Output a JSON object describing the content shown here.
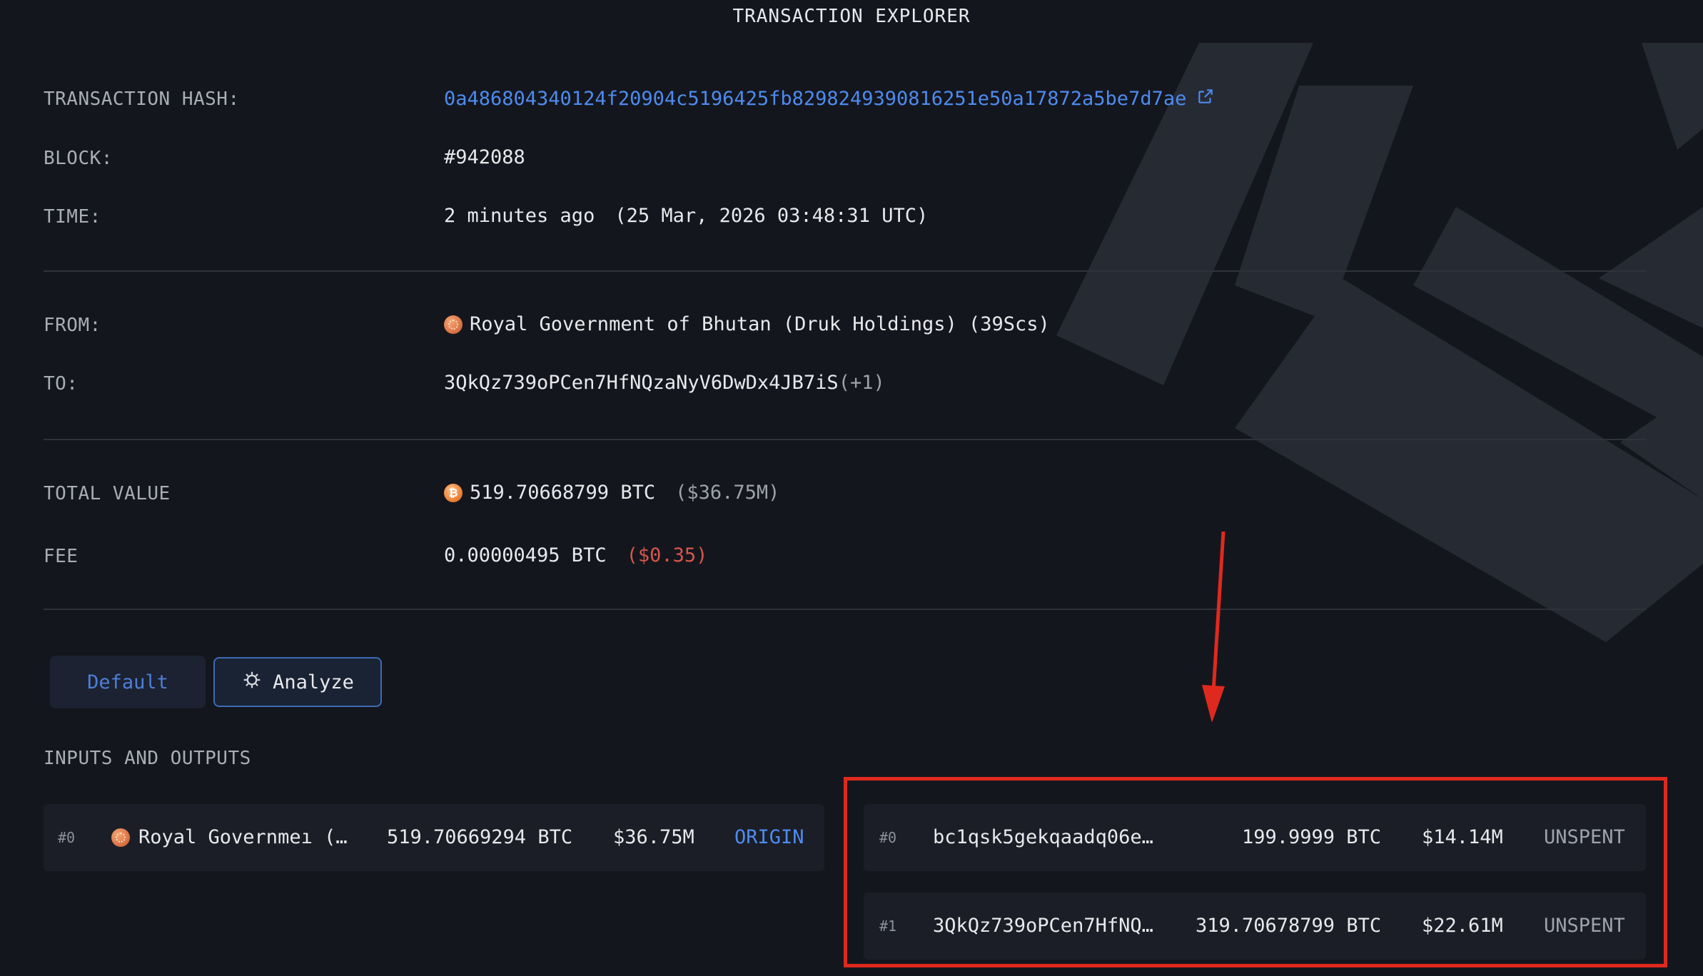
{
  "page": {
    "title": "TRANSACTION EXPLORER"
  },
  "details": {
    "hash_label": "TRANSACTION HASH:",
    "hash_value": "0a486804340124f20904c5196425fb8298249390816251e50a17872a5be7d7ae",
    "block_label": "BLOCK:",
    "block_value": "#942088",
    "time_label": "TIME:",
    "time_relative": "2 minutes ago",
    "time_absolute": "(25 Mar, 2026 03:48:31 UTC)",
    "from_label": "FROM:",
    "from_value": "Royal Government of Bhutan (Druk Holdings) (39Scs)",
    "to_label": "TO:",
    "to_value": "3QkQz739oPCen7HfNQzaNyV6DwDx4JB7iS",
    "to_extra": "(+1)",
    "total_label": "TOTAL VALUE",
    "total_value": "519.70668799 BTC",
    "total_usd": "($36.75M)",
    "fee_label": "FEE",
    "fee_value": "0.00000495 BTC",
    "fee_usd": "($0.35)"
  },
  "tabs": {
    "default_label": "Default",
    "analyze_label": "Analyze"
  },
  "io": {
    "heading": "INPUTS AND OUTPUTS",
    "inputs": [
      {
        "index": "#0",
        "name": "Royal Governmeı (…",
        "amount": "519.70669294 BTC",
        "usd": "$36.75M",
        "status": "ORIGIN"
      }
    ],
    "outputs": [
      {
        "index": "#0",
        "address": "bc1qsk5gekqaadq06e…",
        "amount": "199.9999 BTC",
        "usd": "$14.14M",
        "status": "UNSPENT"
      },
      {
        "index": "#1",
        "address": "3QkQz739oPCen7HfNQ…",
        "amount": "319.70678799 BTC",
        "usd": "$22.61M",
        "status": "UNSPENT"
      }
    ]
  },
  "icons": {
    "entity": "bhutan-entity-icon",
    "btc": "bitcoin-icon",
    "external": "external-link-icon",
    "analyze": "analyze-icon"
  },
  "colors": {
    "background": "#14161d",
    "link": "#4d8bf0",
    "fee_usd": "#d6564c",
    "annotation": "#e0291e",
    "active_tab_border": "#3d6bb8"
  }
}
